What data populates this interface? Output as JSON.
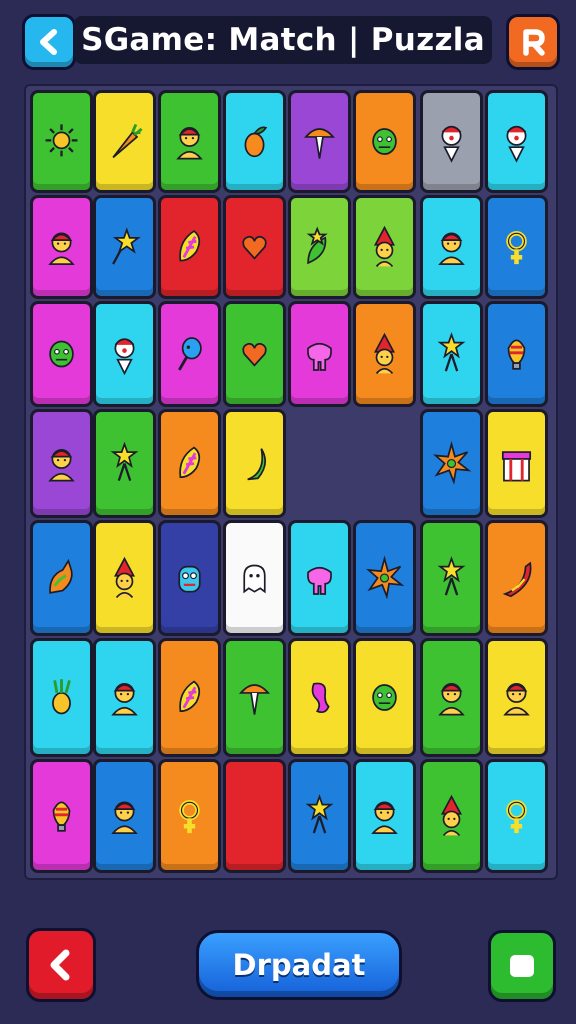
{
  "header": {
    "title": "SGame: Match | Puzzla"
  },
  "footer": {
    "primary_label": "Drpadat"
  },
  "palette": {
    "red": "#e2242c",
    "orange": "#f58a1f",
    "yellow": "#f7de2a",
    "green": "#3fc232",
    "lime": "#7cd43a",
    "cyan": "#2fd5ee",
    "blue": "#1f7fdc",
    "purple": "#9a47d6",
    "magenta": "#e33ad9",
    "gray": "#9aa0ae",
    "white": "#fafafa",
    "navy": "#3440a6"
  },
  "tiles": [
    {
      "id": "r1c1",
      "color": "green",
      "icon": "sun-icon"
    },
    {
      "id": "r1c2",
      "color": "yellow",
      "icon": "carrot-icon"
    },
    {
      "id": "r1c3",
      "color": "green",
      "icon": "person-icon"
    },
    {
      "id": "r1c4",
      "color": "cyan",
      "icon": "fruit-icon"
    },
    {
      "id": "r1c5",
      "color": "purple",
      "icon": "mushroom-icon"
    },
    {
      "id": "r1c6",
      "color": "orange",
      "icon": "monster-icon"
    },
    {
      "id": "r1c7",
      "color": "gray",
      "icon": "clown-icon"
    },
    {
      "id": "r1c8",
      "color": "cyan",
      "icon": "clown-icon"
    },
    {
      "id": "r2c1",
      "color": "magenta",
      "icon": "person-icon"
    },
    {
      "id": "r2c2",
      "color": "blue",
      "icon": "star-wand-icon"
    },
    {
      "id": "r2c3",
      "color": "red",
      "icon": "feather-icon"
    },
    {
      "id": "r2c4",
      "color": "red",
      "icon": "heart-icon"
    },
    {
      "id": "r2c5",
      "color": "lime",
      "icon": "leaf-star-icon"
    },
    {
      "id": "r2c6",
      "color": "lime",
      "icon": "gnome-icon"
    },
    {
      "id": "r2c7",
      "color": "cyan",
      "icon": "person-icon"
    },
    {
      "id": "r2c8",
      "color": "blue",
      "icon": "female-symbol-icon"
    },
    {
      "id": "r3c1",
      "color": "magenta",
      "icon": "monster-icon"
    },
    {
      "id": "r3c2",
      "color": "cyan",
      "icon": "clown-icon"
    },
    {
      "id": "r3c3",
      "color": "magenta",
      "icon": "balloon-icon"
    },
    {
      "id": "r3c4",
      "color": "green",
      "icon": "heart-icon"
    },
    {
      "id": "r3c5",
      "color": "magenta",
      "icon": "elephant-icon"
    },
    {
      "id": "r3c6",
      "color": "orange",
      "icon": "gnome-icon"
    },
    {
      "id": "r3c7",
      "color": "cyan",
      "icon": "star-figure-icon"
    },
    {
      "id": "r3c8",
      "color": "blue",
      "icon": "bulb-icon"
    },
    {
      "id": "r4c1",
      "color": "purple",
      "icon": "person-icon"
    },
    {
      "id": "r4c2",
      "color": "green",
      "icon": "star-figure-icon"
    },
    {
      "id": "r4c3",
      "color": "orange",
      "icon": "feather-icon"
    },
    {
      "id": "r4c4",
      "color": "yellow",
      "icon": "banana-icon"
    },
    {
      "id": "r4c7",
      "color": "blue",
      "icon": "starburst-icon"
    },
    {
      "id": "r4c8",
      "color": "yellow",
      "icon": "gift-icon"
    },
    {
      "id": "r5c1",
      "color": "blue",
      "icon": "bird-icon"
    },
    {
      "id": "r5c2",
      "color": "yellow",
      "icon": "gnome-icon"
    },
    {
      "id": "r5c3",
      "color": "navy",
      "icon": "robot-icon"
    },
    {
      "id": "r5c4",
      "color": "white",
      "icon": "ghost-icon"
    },
    {
      "id": "r5c5",
      "color": "cyan",
      "icon": "elephant-icon"
    },
    {
      "id": "r5c6",
      "color": "blue",
      "icon": "starburst-icon"
    },
    {
      "id": "r5c7",
      "color": "green",
      "icon": "star-figure-icon"
    },
    {
      "id": "r5c8",
      "color": "orange",
      "icon": "pepper-icon"
    },
    {
      "id": "r6c1",
      "color": "cyan",
      "icon": "pineapple-icon"
    },
    {
      "id": "r6c2",
      "color": "cyan",
      "icon": "person-icon"
    },
    {
      "id": "r6c3",
      "color": "orange",
      "icon": "feather-icon"
    },
    {
      "id": "r6c4",
      "color": "green",
      "icon": "mushroom-icon"
    },
    {
      "id": "r6c5",
      "color": "yellow",
      "icon": "seahorse-icon"
    },
    {
      "id": "r6c6",
      "color": "yellow",
      "icon": "monster-icon"
    },
    {
      "id": "r6c7",
      "color": "green",
      "icon": "person-icon"
    },
    {
      "id": "r6c8",
      "color": "yellow",
      "icon": "person-icon"
    },
    {
      "id": "r7c1",
      "color": "magenta",
      "icon": "bulb-icon"
    },
    {
      "id": "r7c2",
      "color": "blue",
      "icon": "person-icon"
    },
    {
      "id": "r7c3",
      "color": "orange",
      "icon": "female-symbol-icon"
    },
    {
      "id": "r7c4",
      "color": "red",
      "icon": "blank-icon"
    },
    {
      "id": "r7c5",
      "color": "blue",
      "icon": "star-figure-icon"
    },
    {
      "id": "r7c6",
      "color": "cyan",
      "icon": "person-icon"
    },
    {
      "id": "r7c7",
      "color": "green",
      "icon": "gnome-icon"
    },
    {
      "id": "r7c8",
      "color": "cyan",
      "icon": "female-symbol-icon"
    }
  ]
}
